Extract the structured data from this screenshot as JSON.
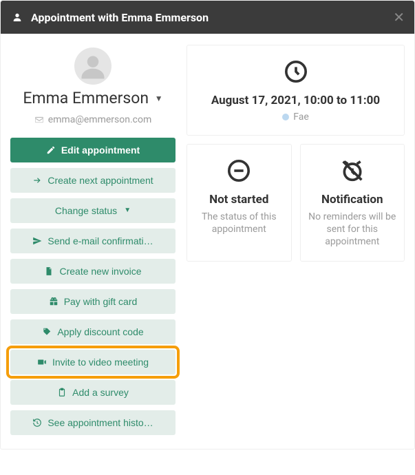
{
  "header": {
    "title": "Appointment with Emma Emmerson"
  },
  "person": {
    "name": "Emma Emmerson",
    "email": "emma@emmerson.com"
  },
  "actions": {
    "edit": "Edit appointment",
    "create_next": "Create next appointment",
    "change_status": "Change status",
    "send_email": "Send e-mail confirmati…",
    "create_invoice": "Create new invoice",
    "pay_gift": "Pay with gift card",
    "apply_discount": "Apply discount code",
    "invite_video": "Invite to video meeting",
    "add_survey": "Add a survey",
    "history": "See appointment histo…"
  },
  "info": {
    "datetime": "August 17, 2021, 10:00 to 11:00",
    "tag": "Fae",
    "status_title": "Not started",
    "status_sub": "The status of this appointment",
    "notif_title": "Notification",
    "notif_sub": "No reminders will be sent for this appointment"
  },
  "colors": {
    "accent": "#2e8b6a",
    "highlight": "#f59e0b"
  }
}
